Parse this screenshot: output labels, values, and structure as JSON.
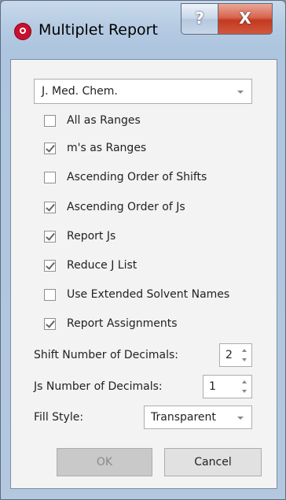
{
  "window": {
    "title": "Multiplet Report",
    "help_glyph": "?",
    "close_glyph": "X",
    "icon": "app-logo-icon"
  },
  "journal_combo": {
    "value": "J. Med. Chem."
  },
  "checkboxes": [
    {
      "label": "All as Ranges",
      "checked": false
    },
    {
      "label": "m's as Ranges",
      "checked": true
    },
    {
      "label": "Ascending Order of Shifts",
      "checked": false
    },
    {
      "label": "Ascending Order of Js",
      "checked": true
    },
    {
      "label": "Report Js",
      "checked": true
    },
    {
      "label": "Reduce J List",
      "checked": true
    },
    {
      "label": "Use Extended Solvent Names",
      "checked": false
    },
    {
      "label": "Report Assignments",
      "checked": true
    }
  ],
  "shift_decimals": {
    "label": "Shift Number of Decimals:",
    "value": "2"
  },
  "js_decimals": {
    "label": "Js Number of Decimals:",
    "value": "1"
  },
  "fill_style": {
    "label": "Fill Style:",
    "value": "Transparent"
  },
  "buttons": {
    "ok": "OK",
    "cancel": "Cancel"
  }
}
